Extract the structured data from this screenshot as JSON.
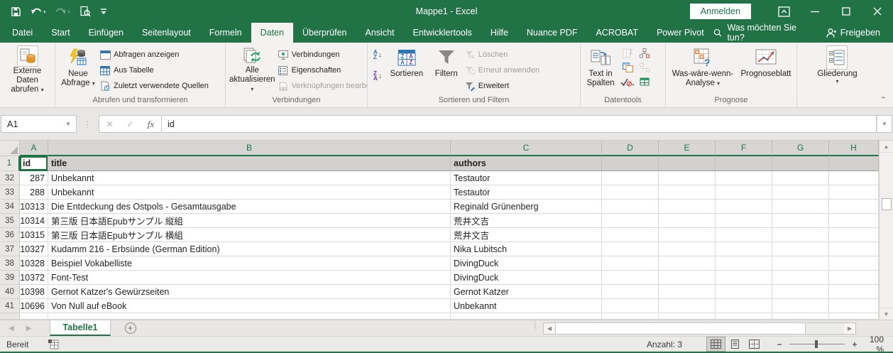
{
  "colors": {
    "accent": "#217346",
    "ribbon_bg": "#f3f2f1",
    "selection_fill": "#d2d1cf"
  },
  "titlebar": {
    "title": "Mappe1 - Excel",
    "signin": "Anmelden"
  },
  "tabrow": {
    "tabs": [
      {
        "label": "Datei"
      },
      {
        "label": "Start"
      },
      {
        "label": "Einfügen"
      },
      {
        "label": "Seitenlayout"
      },
      {
        "label": "Formeln"
      },
      {
        "label": "Daten",
        "active": true
      },
      {
        "label": "Überprüfen"
      },
      {
        "label": "Ansicht"
      },
      {
        "label": "Entwicklertools"
      },
      {
        "label": "Hilfe"
      },
      {
        "label": "Nuance PDF"
      },
      {
        "label": "ACROBAT"
      },
      {
        "label": "Power Pivot"
      }
    ],
    "search": "Was möchten Sie tun?",
    "share": "Freigeben"
  },
  "ribbon": {
    "externe_daten": {
      "line1": "Externe Daten",
      "line2": "abrufen"
    },
    "abrufen": {
      "caption": "Abrufen und transformieren",
      "big1": "Neue",
      "big2": "Abfrage",
      "items": [
        "Abfragen anzeigen",
        "Aus Tabelle",
        "Zuletzt verwendete Quellen"
      ]
    },
    "verbindungen": {
      "caption": "Verbindungen",
      "big1": "Alle",
      "big2": "aktualisieren",
      "items": [
        "Verbindungen",
        "Eigenschaften",
        "Verknüpfungen bearbeiten"
      ]
    },
    "sortieren": {
      "caption": "Sortieren und Filtern",
      "sort_label": "Sortieren",
      "filter_label": "Filtern",
      "items": [
        "Löschen",
        "Erneut anwenden",
        "Erweitert"
      ]
    },
    "datentools": {
      "caption": "Datentools",
      "big1": "Text in",
      "big2": "Spalten"
    },
    "prognose": {
      "caption": "Prognose",
      "wwa1": "Was-wäre-wenn-",
      "wwa2": "Analyse",
      "blatt": "Prognoseblatt"
    },
    "gliederung": {
      "label": "Gliederung"
    }
  },
  "formula_bar": {
    "name_box": "A1",
    "value": "id"
  },
  "grid": {
    "columns": [
      "A",
      "B",
      "C",
      "D",
      "E",
      "F",
      "G",
      "H"
    ],
    "header_row": {
      "num": "1",
      "id": "id",
      "title": "title",
      "authors": "authors"
    },
    "rows": [
      {
        "num": "32",
        "id": "287",
        "title": "Unbekannt",
        "authors": "Testautor"
      },
      {
        "num": "33",
        "id": "288",
        "title": "Unbekannt",
        "authors": "Testautor"
      },
      {
        "num": "34",
        "id": "10313",
        "title": "Die Entdeckung des Ostpols - Gesamtausgabe",
        "authors": "Reginald Grünenberg"
      },
      {
        "num": "35",
        "id": "10314",
        "title": "第三版 日本語Epubサンプル 縦組",
        "authors": "荒井文吉"
      },
      {
        "num": "36",
        "id": "10315",
        "title": "第三版 日本語Epubサンプル 横組",
        "authors": "荒井文吉"
      },
      {
        "num": "37",
        "id": "10327",
        "title": "Kudamm 216 - Erbsünde (German Edition)",
        "authors": "Nika Lubitsch"
      },
      {
        "num": "38",
        "id": "10328",
        "title": "Beispiel Vokabelliste",
        "authors": "DivingDuck"
      },
      {
        "num": "39",
        "id": "10372",
        "title": "Font-Test",
        "authors": "DivingDuck"
      },
      {
        "num": "40",
        "id": "10398",
        "title": "Gernot Katzer's Gewürzseiten",
        "authors": "Gernot Katzer"
      },
      {
        "num": "41",
        "id": "10696",
        "title": "Von Null auf eBook",
        "authors": "Unbekannt"
      }
    ]
  },
  "sheet_tabs": {
    "active": "Tabelle1"
  },
  "status_bar": {
    "mode": "Bereit",
    "count": "Anzahl: 3",
    "zoom": "100 %"
  }
}
